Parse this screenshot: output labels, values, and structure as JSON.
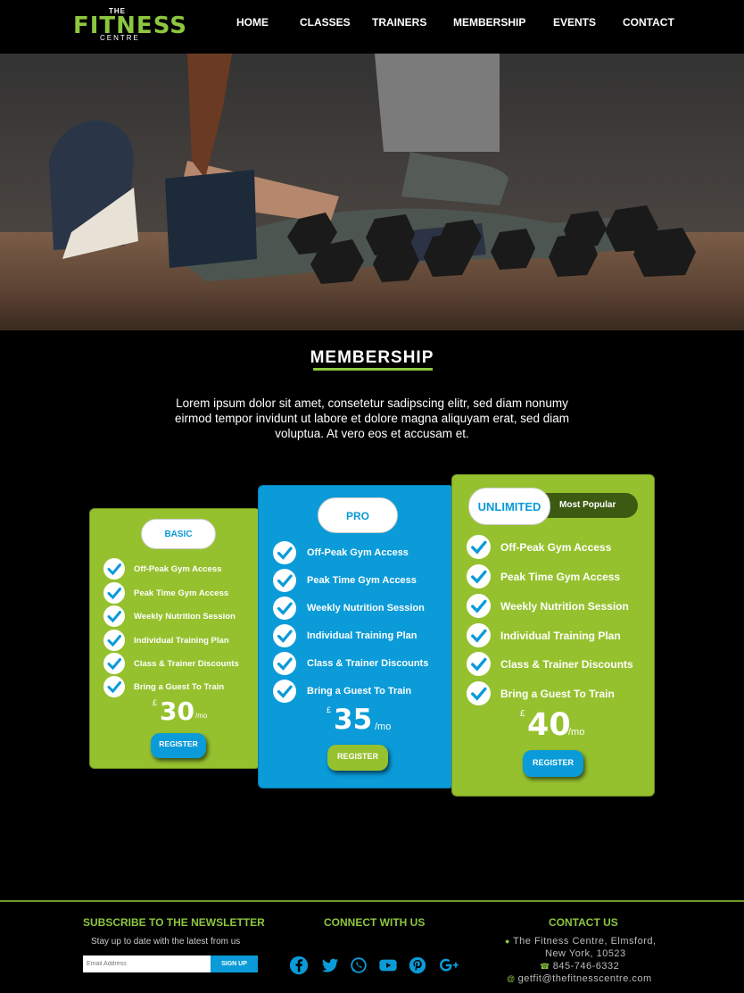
{
  "brand": {
    "top": "THE",
    "main": "FITNESS",
    "bottom": "CENTRE",
    "accent_color": "#8dc63f"
  },
  "nav": {
    "items": [
      {
        "label": "HOME"
      },
      {
        "label": "CLASSES"
      },
      {
        "label": "TRAINERS"
      },
      {
        "label": "MEMBERSHIP"
      },
      {
        "label": "EVENTS"
      },
      {
        "label": "CONTACT"
      }
    ]
  },
  "membership": {
    "title": "MEMBERSHIP",
    "intro": "Lorem ipsum dolor sit amet, consetetur sadipscing elitr, sed diam nonumy eirmod tempor invidunt ut labore et dolore magna aliquyam erat, sed diam voluptua. At vero eos et accusam et.",
    "plans": [
      {
        "name": "BASIC",
        "color": "#96c12e",
        "features": [
          "Off-Peak Gym Access",
          "Peak Time Gym Access",
          "Weekly Nutrition Session",
          "Individual Training Plan",
          "Class & Trainer Discounts",
          "Bring a Guest To Train"
        ],
        "currency": "£",
        "price": "30",
        "period": "/mo",
        "button": "REGISTER"
      },
      {
        "name": "PRO",
        "color": "#0a9bd8",
        "features": [
          "Off-Peak Gym Access",
          "Peak Time Gym Access",
          "Weekly Nutrition Session",
          "Individual Training Plan",
          "Class & Trainer Discounts",
          "Bring a Guest To Train"
        ],
        "currency": "£",
        "price": "35",
        "period": "/mo",
        "button": "REGISTER"
      },
      {
        "name": "UNLIMITED",
        "badge": "Most Popular",
        "color": "#96c12e",
        "features": [
          "Off-Peak Gym Access",
          "Peak Time Gym Access",
          "Weekly Nutrition Session",
          "Individual Training Plan",
          "Class & Trainer Discounts",
          "Bring a Guest To Train"
        ],
        "currency": "£",
        "price": "40",
        "period": "/mo",
        "button": "REGISTER"
      }
    ]
  },
  "footer": {
    "newsletter": {
      "heading": "SUBSCRIBE TO THE NEWSLETTER",
      "subtext": "Stay up to date with the latest from us",
      "placeholder": "Email Address",
      "button": "SIGN UP"
    },
    "connect": {
      "heading": "CONNECT WITH US",
      "icons": [
        "facebook-icon",
        "twitter-icon",
        "whatsapp-icon",
        "youtube-icon",
        "pinterest-icon",
        "google-plus-icon"
      ]
    },
    "contact": {
      "heading": "CONTACT US",
      "address_line1": "The Fitness Centre, Elmsford,",
      "address_line2": "New York, 10523",
      "phone": "845-746-6332",
      "email": "getfit@thefitnesscentre.com"
    }
  }
}
